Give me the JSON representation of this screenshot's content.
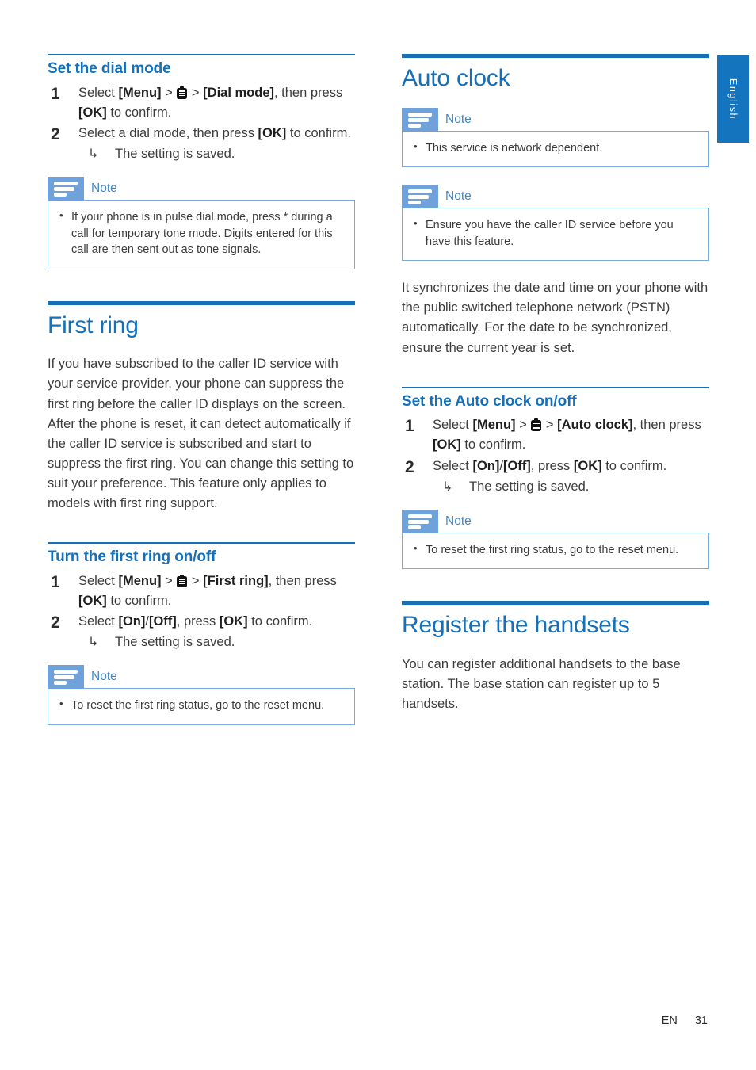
{
  "meta": {
    "language_tab": "English",
    "footer_language": "EN",
    "footer_page": "31",
    "accent_blue": "#1570b9",
    "note_icon_blue": "#6fa2da",
    "note_border_blue": "#7aa9dd",
    "tab_blue": "#1474bd"
  },
  "left_column": {
    "dial_mode": {
      "heading": "Set the dial mode",
      "steps": [
        {
          "num": "1",
          "parts": [
            {
              "t": "text",
              "v": "Select "
            },
            {
              "t": "bold",
              "v": "[Menu]"
            },
            {
              "t": "text",
              "v": " > "
            },
            {
              "t": "icon",
              "v": "menu-icon"
            },
            {
              "t": "text",
              "v": " > "
            },
            {
              "t": "bold",
              "v": "[Dial mode]"
            },
            {
              "t": "text",
              "v": ", then press "
            },
            {
              "t": "bold",
              "v": "[OK]"
            },
            {
              "t": "text",
              "v": " to confirm."
            }
          ]
        },
        {
          "num": "2",
          "parts": [
            {
              "t": "text",
              "v": "Select a dial mode, then press "
            },
            {
              "t": "bold",
              "v": "[OK]"
            },
            {
              "t": "text",
              "v": " to confirm."
            }
          ],
          "result": "The setting is saved."
        }
      ],
      "note": {
        "title": "Note",
        "items": [
          "If your phone is in pulse dial mode, press * during a call for temporary tone mode. Digits entered for this call are then sent out as tone signals."
        ]
      }
    },
    "first_ring": {
      "heading": "First ring",
      "paragraph": "If you have subscribed to the caller ID service with your service provider, your phone can suppress the first ring before the caller ID displays on the screen. After the phone is reset, it can detect automatically if the caller ID service is subscribed and start to suppress the first ring. You can change this setting to suit your preference. This feature only applies to models with first ring support.",
      "subsection": {
        "heading": "Turn the first ring on/off",
        "steps": [
          {
            "num": "1",
            "parts": [
              {
                "t": "text",
                "v": "Select "
              },
              {
                "t": "bold",
                "v": "[Menu]"
              },
              {
                "t": "text",
                "v": " > "
              },
              {
                "t": "icon",
                "v": "menu-icon"
              },
              {
                "t": "text",
                "v": " > "
              },
              {
                "t": "bold",
                "v": "[First ring]"
              },
              {
                "t": "text",
                "v": ", then press "
              },
              {
                "t": "bold",
                "v": "[OK]"
              },
              {
                "t": "text",
                "v": " to confirm."
              }
            ]
          },
          {
            "num": "2",
            "parts": [
              {
                "t": "text",
                "v": "Select "
              },
              {
                "t": "bold",
                "v": "[On]"
              },
              {
                "t": "text",
                "v": "/"
              },
              {
                "t": "bold",
                "v": "[Off]"
              },
              {
                "t": "text",
                "v": ", press "
              },
              {
                "t": "bold",
                "v": "[OK]"
              },
              {
                "t": "text",
                "v": " to confirm."
              }
            ],
            "result": "The setting is saved."
          }
        ],
        "note": {
          "title": "Note",
          "items": [
            "To reset the first ring status, go to the reset menu."
          ]
        }
      }
    }
  },
  "right_column": {
    "auto_clock": {
      "heading": "Auto clock",
      "note_1": {
        "title": "Note",
        "items": [
          "This service is network dependent."
        ]
      },
      "note_2": {
        "title": "Note",
        "items": [
          "Ensure you have the caller ID service before you have this feature."
        ]
      },
      "paragraph": "It synchronizes the date and time on your phone with the public switched telephone network (PSTN) automatically. For the date to be synchronized, ensure the current year is set.",
      "subsection": {
        "heading": "Set the Auto clock on/off",
        "steps": [
          {
            "num": "1",
            "parts": [
              {
                "t": "text",
                "v": "Select "
              },
              {
                "t": "bold",
                "v": "[Menu]"
              },
              {
                "t": "text",
                "v": " > "
              },
              {
                "t": "icon",
                "v": "menu-icon"
              },
              {
                "t": "text",
                "v": " > "
              },
              {
                "t": "bold",
                "v": "[Auto clock]"
              },
              {
                "t": "text",
                "v": ", then press "
              },
              {
                "t": "bold",
                "v": "[OK]"
              },
              {
                "t": "text",
                "v": " to confirm."
              }
            ]
          },
          {
            "num": "2",
            "parts": [
              {
                "t": "text",
                "v": "Select "
              },
              {
                "t": "bold",
                "v": "[On]"
              },
              {
                "t": "text",
                "v": "/"
              },
              {
                "t": "bold",
                "v": "[Off]"
              },
              {
                "t": "text",
                "v": ", press "
              },
              {
                "t": "bold",
                "v": "[OK]"
              },
              {
                "t": "text",
                "v": " to confirm."
              }
            ],
            "result": "The setting is saved."
          }
        ],
        "note": {
          "title": "Note",
          "items": [
            "To reset the first ring status, go to the reset menu."
          ]
        }
      }
    },
    "register_handsets": {
      "heading": "Register the handsets",
      "paragraph": "You can register additional handsets to the base station. The base station can register up to 5 handsets."
    }
  }
}
